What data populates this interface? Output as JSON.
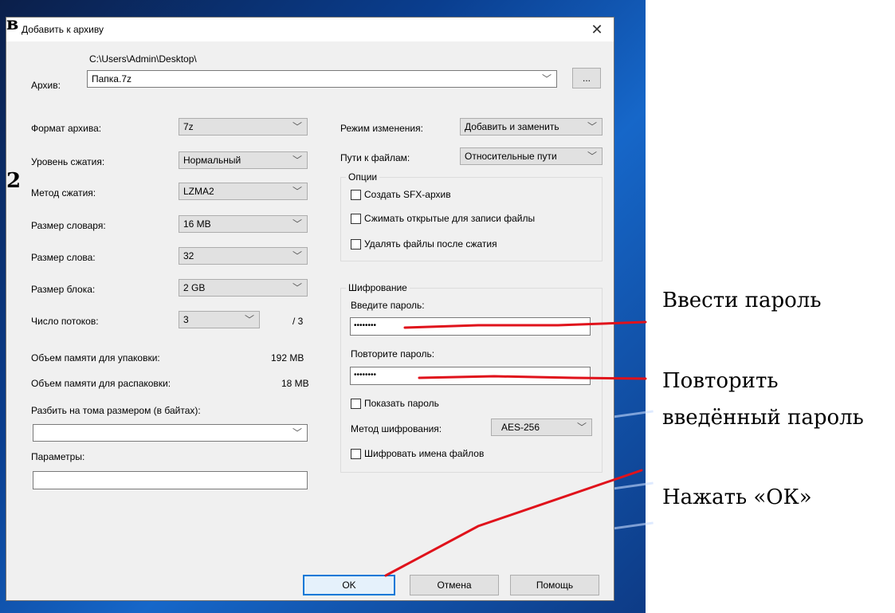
{
  "overlay": {
    "top_mark": "в",
    "side_mark": "2"
  },
  "dialog": {
    "title": "Добавить к архиву",
    "close_glyph": "✕",
    "archive_label": "Архив:",
    "archive_path": "C:\\Users\\Admin\\Desktop\\",
    "archive_name": "Папка.7z",
    "browse_label": "...",
    "left": {
      "format_label": "Формат архива:",
      "format_value": "7z",
      "level_label": "Уровень сжатия:",
      "level_value": "Нормальный",
      "method_label": "Метод сжатия:",
      "method_value": "LZMA2",
      "dict_label": "Размер словаря:",
      "dict_value": "16 MB",
      "word_label": "Размер слова:",
      "word_value": "32",
      "block_label": "Размер блока:",
      "block_value": "2 GB",
      "threads_label": "Число потоков:",
      "threads_value": "3",
      "threads_total": "/ 3",
      "mem_pack_label": "Объем памяти для упаковки:",
      "mem_pack_value": "192 MB",
      "mem_unpack_label": "Объем памяти для распаковки:",
      "mem_unpack_value": "18 MB",
      "split_label": "Разбить на тома размером (в байтах):",
      "split_value": "",
      "params_label": "Параметры:",
      "params_value": ""
    },
    "right": {
      "update_label": "Режим изменения:",
      "update_value": "Добавить и заменить",
      "paths_label": "Пути к файлам:",
      "paths_value": "Относительные пути",
      "options_title": "Опции",
      "opt_sfx": "Создать SFX-архив",
      "opt_shared": "Сжимать открытые для записи файлы",
      "opt_delete": "Удалять файлы после сжатия",
      "enc_title": "Шифрование",
      "pass_label": "Введите пароль:",
      "pass_value": "••••••••",
      "repeat_label": "Повторите пароль:",
      "repeat_value": "••••••••",
      "show_pass": "Показать пароль",
      "enc_method_label": "Метод шифрования:",
      "enc_method_value": "AES-256",
      "enc_names": "Шифровать имена файлов"
    },
    "buttons": {
      "ok": "OK",
      "cancel": "Отмена",
      "help": "Помощь"
    }
  },
  "annotations": {
    "enter_password": "Ввести пароль",
    "repeat_line1": "Повторить",
    "repeat_line2": "введённый пароль",
    "press_ok": "Нажать «ОК»"
  },
  "colors": {
    "annotation_line": "#e0121b",
    "default_button_border": "#0078d7"
  }
}
